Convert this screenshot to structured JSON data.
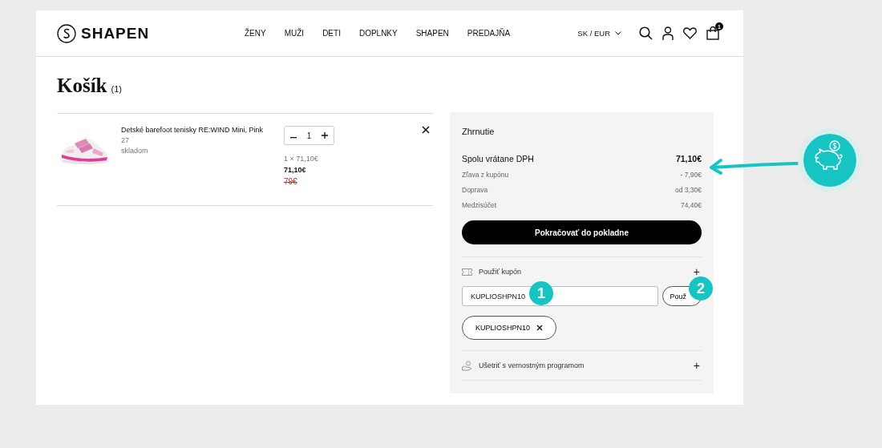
{
  "header": {
    "logo": "SHAPEN",
    "nav": [
      "ŽENY",
      "MUŽI",
      "DETI",
      "DOPLNKY",
      "SHAPEN",
      "PREDAJŇA"
    ],
    "locale": "SK / EUR",
    "cart_badge": "1"
  },
  "cart": {
    "title": "Košík",
    "count": "(1)",
    "items": [
      {
        "name": "Detské barefoot tenisky RE:WIND Mini, Pink",
        "size": "27",
        "stock": "skladom",
        "quantity": "1",
        "unit_price": "1 × 71,10€",
        "price": "71,10€",
        "old_price": "79€"
      }
    ]
  },
  "summary": {
    "title": "Zhrnutie",
    "rows": [
      {
        "kind": "total",
        "label": "Spolu vrátane DPH",
        "value": "71,10€"
      },
      {
        "kind": "detail",
        "label": "Zľava z kupónu",
        "value": "- 7,90€"
      },
      {
        "kind": "detail",
        "label": "Doprava",
        "value": "od 3,30€"
      },
      {
        "kind": "detail",
        "label": "Medzisúčet",
        "value": "74,40€"
      }
    ],
    "checkout_button": "Pokračovať do pokladne",
    "coupon": {
      "label": "Použiť kupón",
      "expanded_sign": "+",
      "value": "KUPLIOSHPN10",
      "apply_button": "Použ",
      "applied": "KUPLIOSHPN10"
    },
    "loyalty": {
      "label": "Ušetriť s vernostným programom",
      "sign": "+"
    }
  },
  "annotations": {
    "markers": [
      "1",
      "2"
    ]
  }
}
